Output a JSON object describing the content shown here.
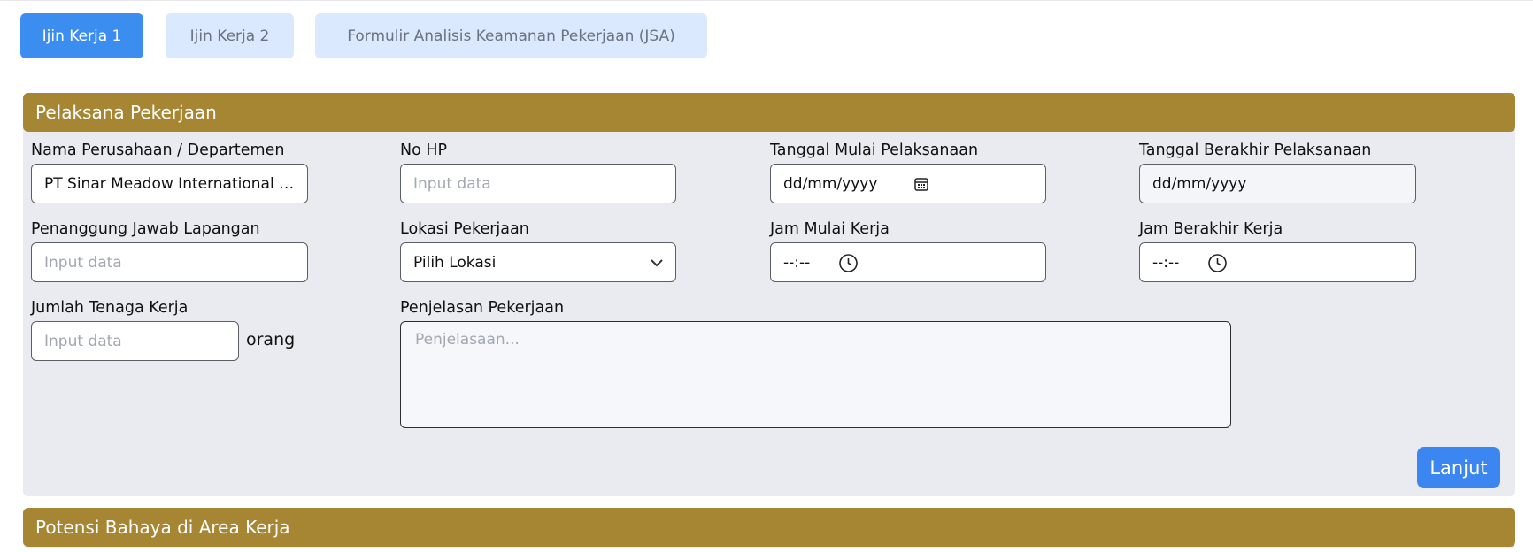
{
  "tabs": [
    {
      "label": "Ijin Kerja 1",
      "active": true
    },
    {
      "label": "Ijin Kerja 2",
      "active": false
    },
    {
      "label": "Formulir Analisis Keamanan Pekerjaan (JSA)",
      "active": false
    }
  ],
  "colors": {
    "accent": "#3b8ef0",
    "tab_inactive_bg": "#dbe9ff",
    "section_header": "#a68533",
    "section_bg": "#e9ebf0"
  },
  "section_1": {
    "title": "Pelaksana Pekerjaan",
    "fields": {
      "company": {
        "label": "Nama Perusahaan / Departemen",
        "value": "PT Sinar Meadow International I..."
      },
      "phone": {
        "label": "No HP",
        "placeholder": "Input data"
      },
      "start_date": {
        "label": "Tanggal Mulai Pelaksanaan",
        "value": "dd/mm/yyyy",
        "icon": "calendar-icon"
      },
      "end_date": {
        "label": "Tanggal Berakhir Pelaksanaan",
        "value": "dd/mm/yyyy"
      },
      "field_supervisor": {
        "label": "Penanggung Jawab Lapangan",
        "placeholder": "Input data"
      },
      "location": {
        "label": "Lokasi Pekerjaan",
        "selected": "Pilih Lokasi",
        "icon": "chevron-down-icon"
      },
      "start_time": {
        "label": "Jam Mulai Kerja",
        "value": "--:--",
        "icon": "clock-icon"
      },
      "end_time": {
        "label": "Jam Berakhir Kerja",
        "value": "--:--",
        "icon": "clock-icon"
      },
      "workforce": {
        "label": "Jumlah Tenaga Kerja",
        "placeholder": "Input data",
        "unit": "orang"
      },
      "description": {
        "label": "Penjelasan Pekerjaan",
        "placeholder": "Penjelasaan..."
      }
    },
    "next_button": "Lanjut"
  },
  "section_2": {
    "title": "Potensi Bahaya di Area Kerja"
  }
}
